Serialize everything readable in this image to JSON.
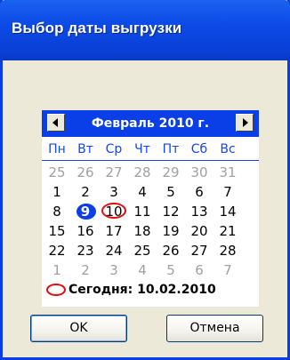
{
  "window": {
    "title": "Выбор даты выгрузки"
  },
  "calendar": {
    "month_label": "Февраль 2010 г.",
    "weekdays": [
      "Пн",
      "Вт",
      "Ср",
      "Чт",
      "Пт",
      "Сб",
      "Вс"
    ],
    "weeks": [
      [
        "25",
        "26",
        "27",
        "28",
        "29",
        "30",
        "31"
      ],
      [
        "1",
        "2",
        "3",
        "4",
        "5",
        "6",
        "7"
      ],
      [
        "8",
        "9",
        "10",
        "11",
        "12",
        "13",
        "14"
      ],
      [
        "15",
        "16",
        "17",
        "18",
        "19",
        "20",
        "21"
      ],
      [
        "22",
        "23",
        "24",
        "25",
        "26",
        "27",
        "28"
      ],
      [
        "1",
        "2",
        "3",
        "4",
        "5",
        "6",
        "7"
      ]
    ],
    "selected_day": "9",
    "today_day": "10",
    "today_text": "Сегодня: 10.02.2010",
    "colors": {
      "header": "#0a3ee6",
      "weekday": "#1747e0",
      "today_ring": "#e01010",
      "muted": "#a0a0a0"
    }
  },
  "buttons": {
    "ok": "OK",
    "cancel": "Отмена"
  }
}
